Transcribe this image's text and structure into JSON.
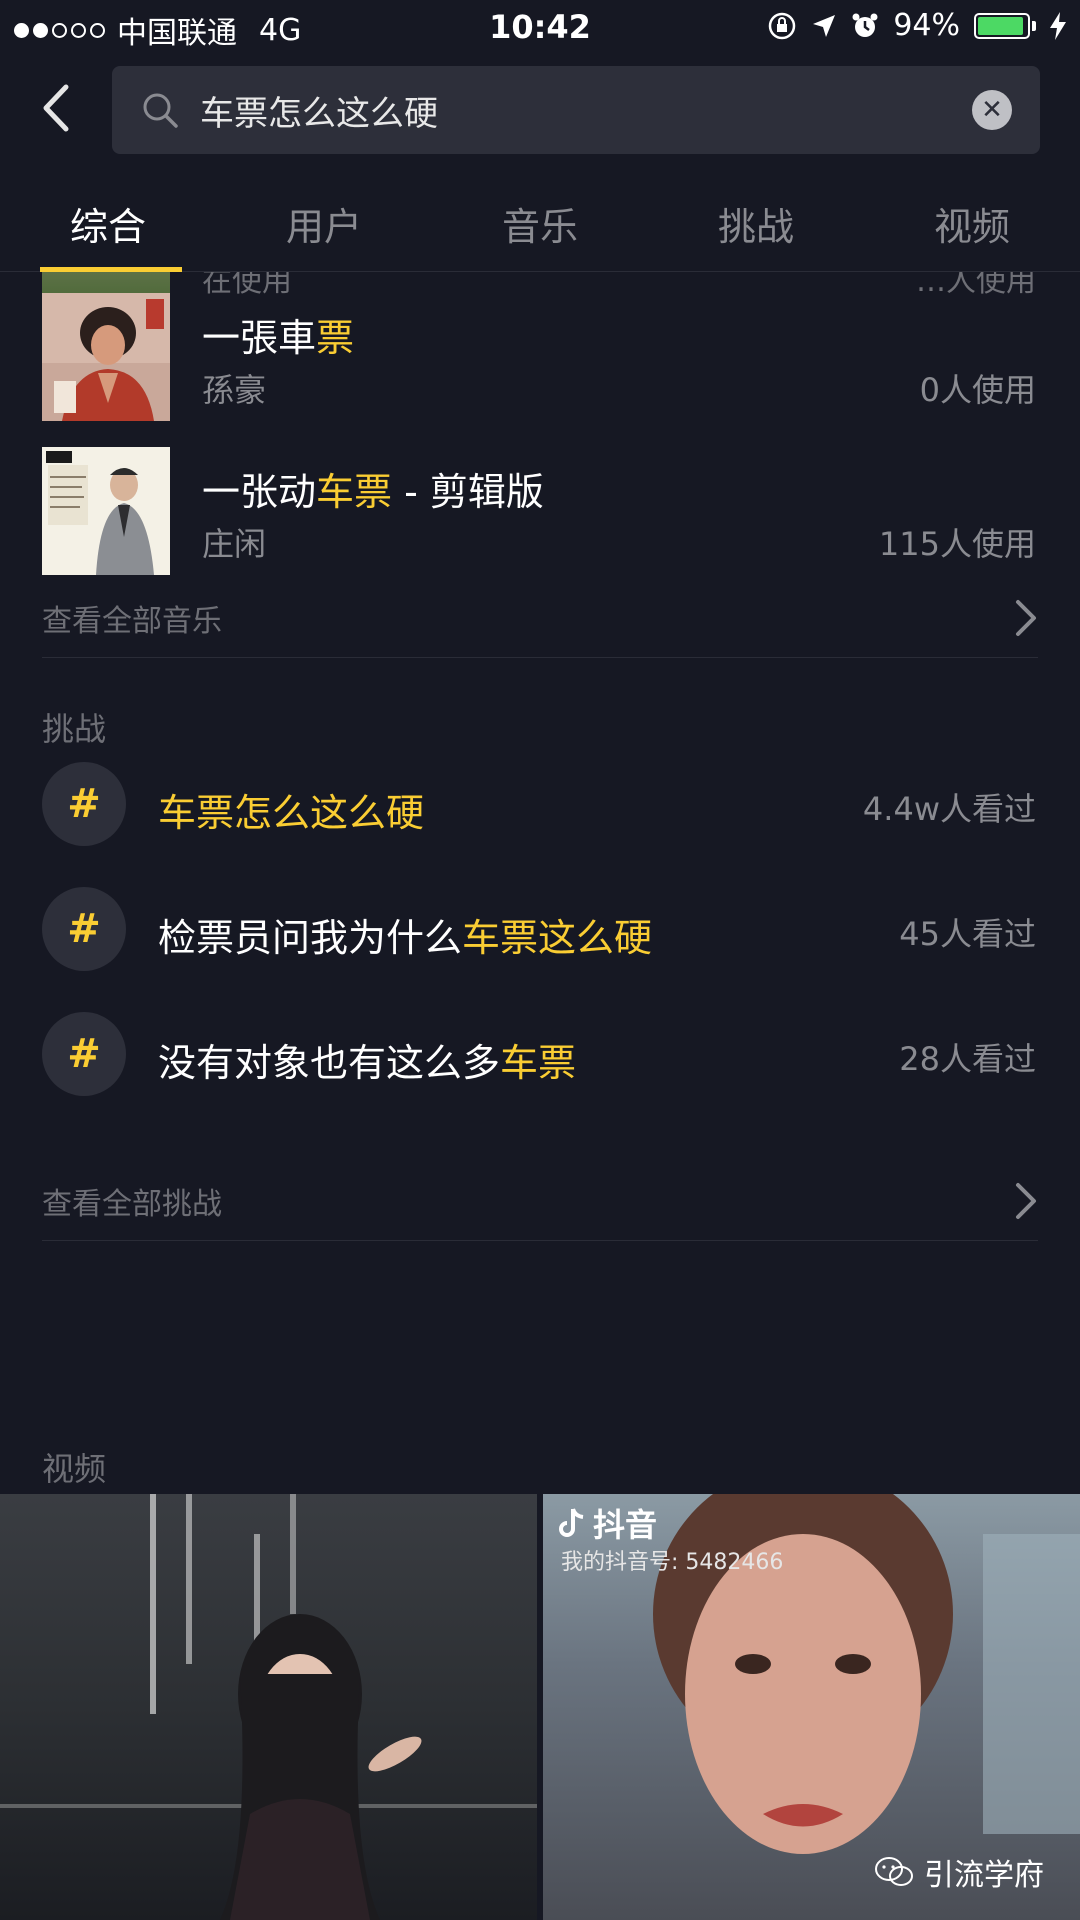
{
  "status_bar": {
    "carrier": "中国联通",
    "network": "4G",
    "time": "10:42",
    "battery": "94%",
    "battery_level": 0.94
  },
  "search": {
    "query": "车票怎么这么硬"
  },
  "tabs": [
    {
      "label": "综合",
      "active": true
    },
    {
      "label": "用户",
      "active": false
    },
    {
      "label": "音乐",
      "active": false
    },
    {
      "label": "挑战",
      "active": false
    },
    {
      "label": "视频",
      "active": false
    }
  ],
  "music": {
    "partial": {
      "title": "在使用",
      "count": "…人使用"
    },
    "items": [
      {
        "title_plain": "一張車",
        "title_highlight": "票",
        "title_rest": "",
        "artist": "孫豪",
        "count": "0人使用"
      },
      {
        "title_plain": "一张动",
        "title_highlight": "车票",
        "title_rest": " - 剪辑版",
        "artist": "庄闲",
        "count": "115人使用"
      }
    ],
    "see_all": "查看全部音乐"
  },
  "challenges": {
    "label": "挑战",
    "items": [
      {
        "plain": "",
        "highlight": "车票怎么这么硬",
        "rest": "",
        "views": "4.4w人看过"
      },
      {
        "plain": "检票员问我为什么",
        "highlight": "车票这么硬",
        "rest": "",
        "views": "45人看过"
      },
      {
        "plain": "没有对象也有这么多",
        "highlight": "车票",
        "rest": "",
        "views": "28人看过"
      }
    ],
    "see_all": "查看全部挑战"
  },
  "videos": {
    "label": "视频",
    "tiktok_brand": "抖音",
    "tiktok_id": "我的抖音号: 5482466",
    "watermark": "引流学府"
  },
  "colors": {
    "background": "#161823",
    "accent": "#facd33",
    "muted": "#8a8b91"
  }
}
